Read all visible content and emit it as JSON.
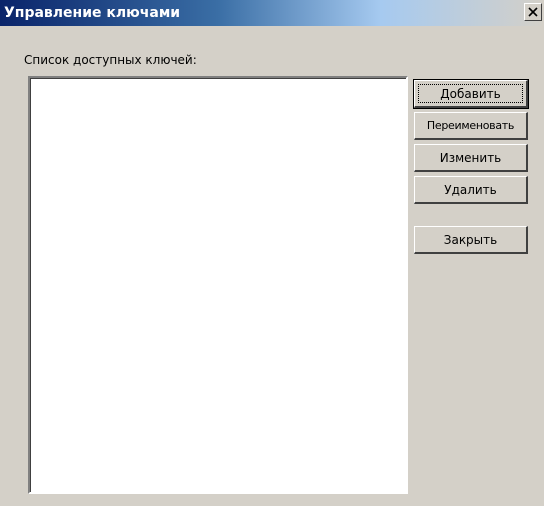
{
  "window": {
    "title": "Управление ключами"
  },
  "list": {
    "label": "Список доступных ключей:"
  },
  "buttons": {
    "add": "Добавить",
    "rename": "Переименовать",
    "edit": "Изменить",
    "delete": "Удалить",
    "close": "Закрыть"
  },
  "colors": {
    "titlebar_start": "#0a246a",
    "titlebar_end": "#d4d0c8",
    "face": "#d4d0c8"
  },
  "icons": {
    "close": "close-icon"
  }
}
